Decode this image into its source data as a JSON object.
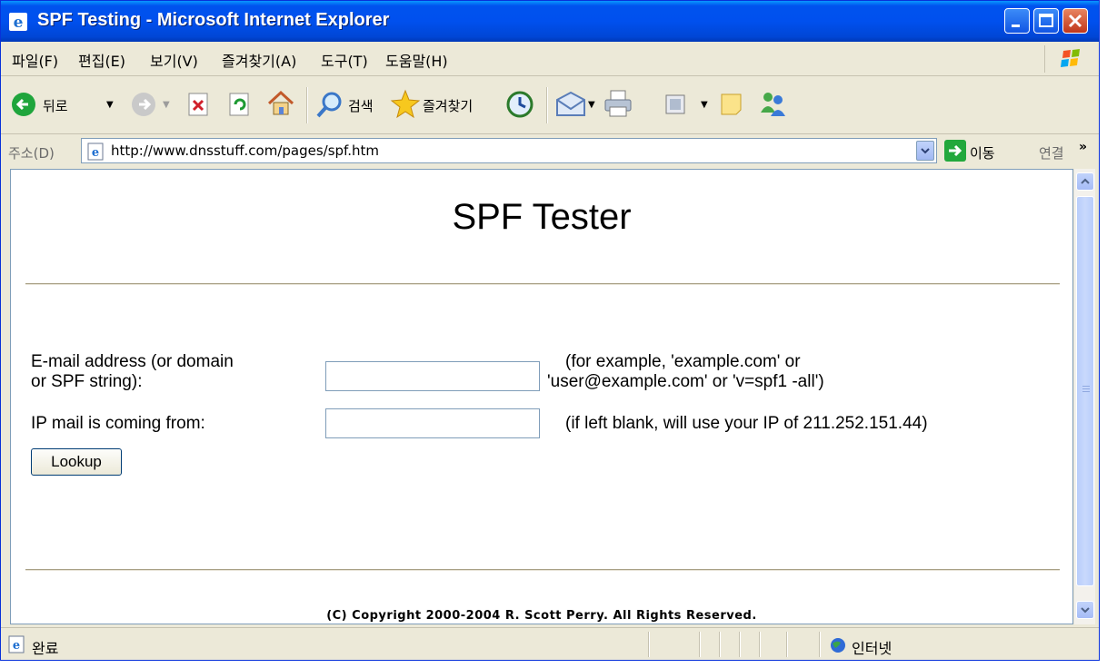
{
  "window": {
    "title": "SPF Testing - Microsoft Internet Explorer"
  },
  "menu": {
    "items": [
      "파일(F)",
      "편집(E)",
      "보기(V)",
      "즐겨찾기(A)",
      "도구(T)",
      "도움말(H)"
    ]
  },
  "toolbar": {
    "back_label": "뒤로",
    "search_label": "검색",
    "favorites_label": "즐겨찾기"
  },
  "address": {
    "label": "주소(D)",
    "url": "http://www.dnsstuff.com/pages/spf.htm",
    "go_label": "이동",
    "links_label": "연결"
  },
  "page": {
    "title": "SPF Tester",
    "email_label_line1": "E-mail address (or domain",
    "email_label_line2": "or SPF string):",
    "email_value": "",
    "email_hint_line1": "(for example, 'example.com' or",
    "email_hint_line2": "'user@example.com' or 'v=spf1 -all')",
    "ip_label": "IP mail is coming from:",
    "ip_value": "",
    "ip_hint": "(if left blank, will use your IP of 211.252.151.44)",
    "lookup_label": "Lookup",
    "copyright": "(C) Copyright 2000-2004 R. Scott Perry. All Rights Reserved."
  },
  "status": {
    "text": "완료",
    "zone": "인터넷"
  },
  "icons": [
    "ie-icon",
    "minimize-icon",
    "maximize-icon",
    "close-icon",
    "windows-flag-icon",
    "back-icon",
    "forward-icon",
    "stop-icon",
    "refresh-icon",
    "home-icon",
    "search-icon",
    "favorites-star-icon",
    "history-icon",
    "mail-icon",
    "print-icon",
    "edit-icon",
    "discuss-icon",
    "messenger-icon",
    "page-icon",
    "go-arrow-icon",
    "internet-globe-icon"
  ]
}
